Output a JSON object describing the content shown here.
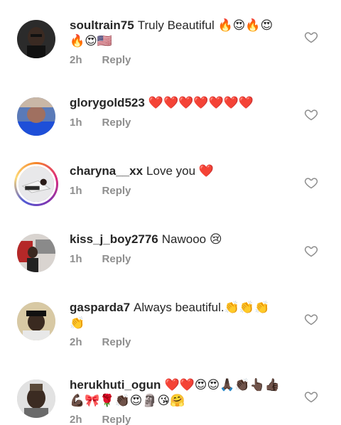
{
  "comments": [
    {
      "username": "soultrain75",
      "text": "Truly Beautiful 🔥😍🔥😍🔥😍🇺🇸",
      "time": "2h",
      "reply": "Reply"
    },
    {
      "username": "glorygold523",
      "text": "❤️❤️❤️❤️❤️❤️❤️",
      "time": "1h",
      "reply": "Reply"
    },
    {
      "username": "charyna__xx",
      "text": "Love you ❤️",
      "time": "1h",
      "reply": "Reply"
    },
    {
      "username": "kiss_j_boy2776",
      "text": "Nawooo 😢",
      "time": "1h",
      "reply": "Reply"
    },
    {
      "username": "gasparda7",
      "text": "Always  beautiful.👏👏👏👏",
      "time": "2h",
      "reply": "Reply"
    },
    {
      "username": "herukhuti_ogun",
      "text": "❤️❤️😍😍🙏🏿👏🏿👆🏿👍🏿💪🏿🎀🌹👏🏿😍🗿😘🤗",
      "time": "2h",
      "reply": "Reply"
    }
  ],
  "icons": {
    "like": "heart-outline-icon"
  },
  "colors": {
    "text": "#262626",
    "meta": "#8e8e8e"
  }
}
